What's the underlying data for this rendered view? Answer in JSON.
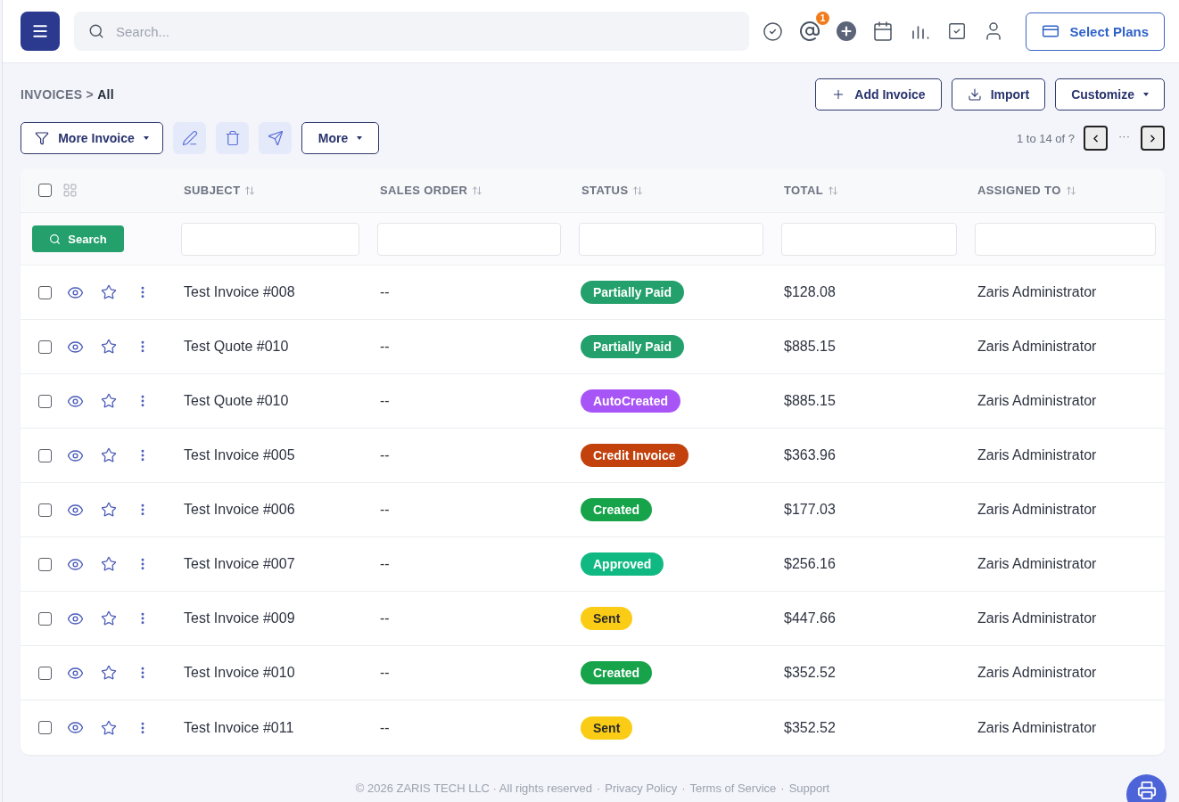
{
  "topbar": {
    "search": {
      "placeholder": "Search..."
    },
    "mention_badge": "1",
    "plans_button": "Select Plans"
  },
  "breadcrumb": "INVOICES > **All**",
  "actions": [
    {
      "kind": "add",
      "label": "Add Invoice"
    },
    {
      "kind": "import",
      "label": "Import"
    },
    {
      "kind": "dropdown",
      "label": "Customize"
    }
  ],
  "toolbar": {
    "filter_button": "More Invoice",
    "more_button": "More"
  },
  "pagination": {
    "range": "1 to 14 of ?",
    "gap": "···"
  },
  "table": {
    "select_all": {
      "checked": false
    },
    "columns": [
      "SUBJECT",
      "SALES ORDER",
      "STATUS",
      "TOTAL",
      "ASSIGNED TO"
    ],
    "search_button": "Search",
    "rows": [
      {
        "checked": false,
        "starred": false,
        "subject": "Test Invoice #008",
        "sales_order": "--",
        "status": {
          "label": "Partially Paid",
          "color": "#23a06b"
        },
        "total": "$128.08",
        "assigned_to": "Zaris Administrator"
      },
      {
        "checked": false,
        "starred": false,
        "subject": "Test Quote #010",
        "sales_order": "--",
        "status": {
          "label": "Partially Paid",
          "color": "#23a06b"
        },
        "total": "$885.15",
        "assigned_to": "Zaris Administrator"
      },
      {
        "checked": false,
        "starred": false,
        "subject": "Test Quote #010",
        "sales_order": "--",
        "status": {
          "label": "AutoCreated",
          "color": "#a855f7"
        },
        "total": "$885.15",
        "assigned_to": "Zaris Administrator"
      },
      {
        "checked": false,
        "starred": false,
        "subject": "Test Invoice #005",
        "sales_order": "--",
        "status": {
          "label": "Credit Invoice",
          "color": "#c2410c"
        },
        "total": "$363.96",
        "assigned_to": "Zaris Administrator"
      },
      {
        "checked": false,
        "starred": false,
        "subject": "Test Invoice #006",
        "sales_order": "--",
        "status": {
          "label": "Created",
          "color": "#16a34a"
        },
        "total": "$177.03",
        "assigned_to": "Zaris Administrator"
      },
      {
        "checked": false,
        "starred": false,
        "subject": "Test Invoice #007",
        "sales_order": "--",
        "status": {
          "label": "Approved",
          "color": "#10b981"
        },
        "total": "$256.16",
        "assigned_to": "Zaris Administrator"
      },
      {
        "checked": false,
        "starred": false,
        "subject": "Test Invoice #009",
        "sales_order": "--",
        "status": {
          "label": "Sent",
          "color": "#facc15"
        },
        "total": "$447.66",
        "assigned_to": "Zaris Administrator"
      },
      {
        "checked": false,
        "starred": false,
        "subject": "Test Invoice #010",
        "sales_order": "--",
        "status": {
          "label": "Created",
          "color": "#16a34a"
        },
        "total": "$352.52",
        "assigned_to": "Zaris Administrator"
      },
      {
        "checked": false,
        "starred": false,
        "subject": "Test Invoice #011",
        "sales_order": "--",
        "status": {
          "label": "Sent",
          "color": "#facc15"
        },
        "total": "$352.52",
        "assigned_to": "Zaris Administrator"
      }
    ]
  },
  "footer": {
    "copyright": "© 2026 ZARIS TECH LLC · All rights reserved",
    "separator": "·",
    "links": [
      "Privacy Policy",
      "Terms of Service",
      "Support"
    ]
  }
}
